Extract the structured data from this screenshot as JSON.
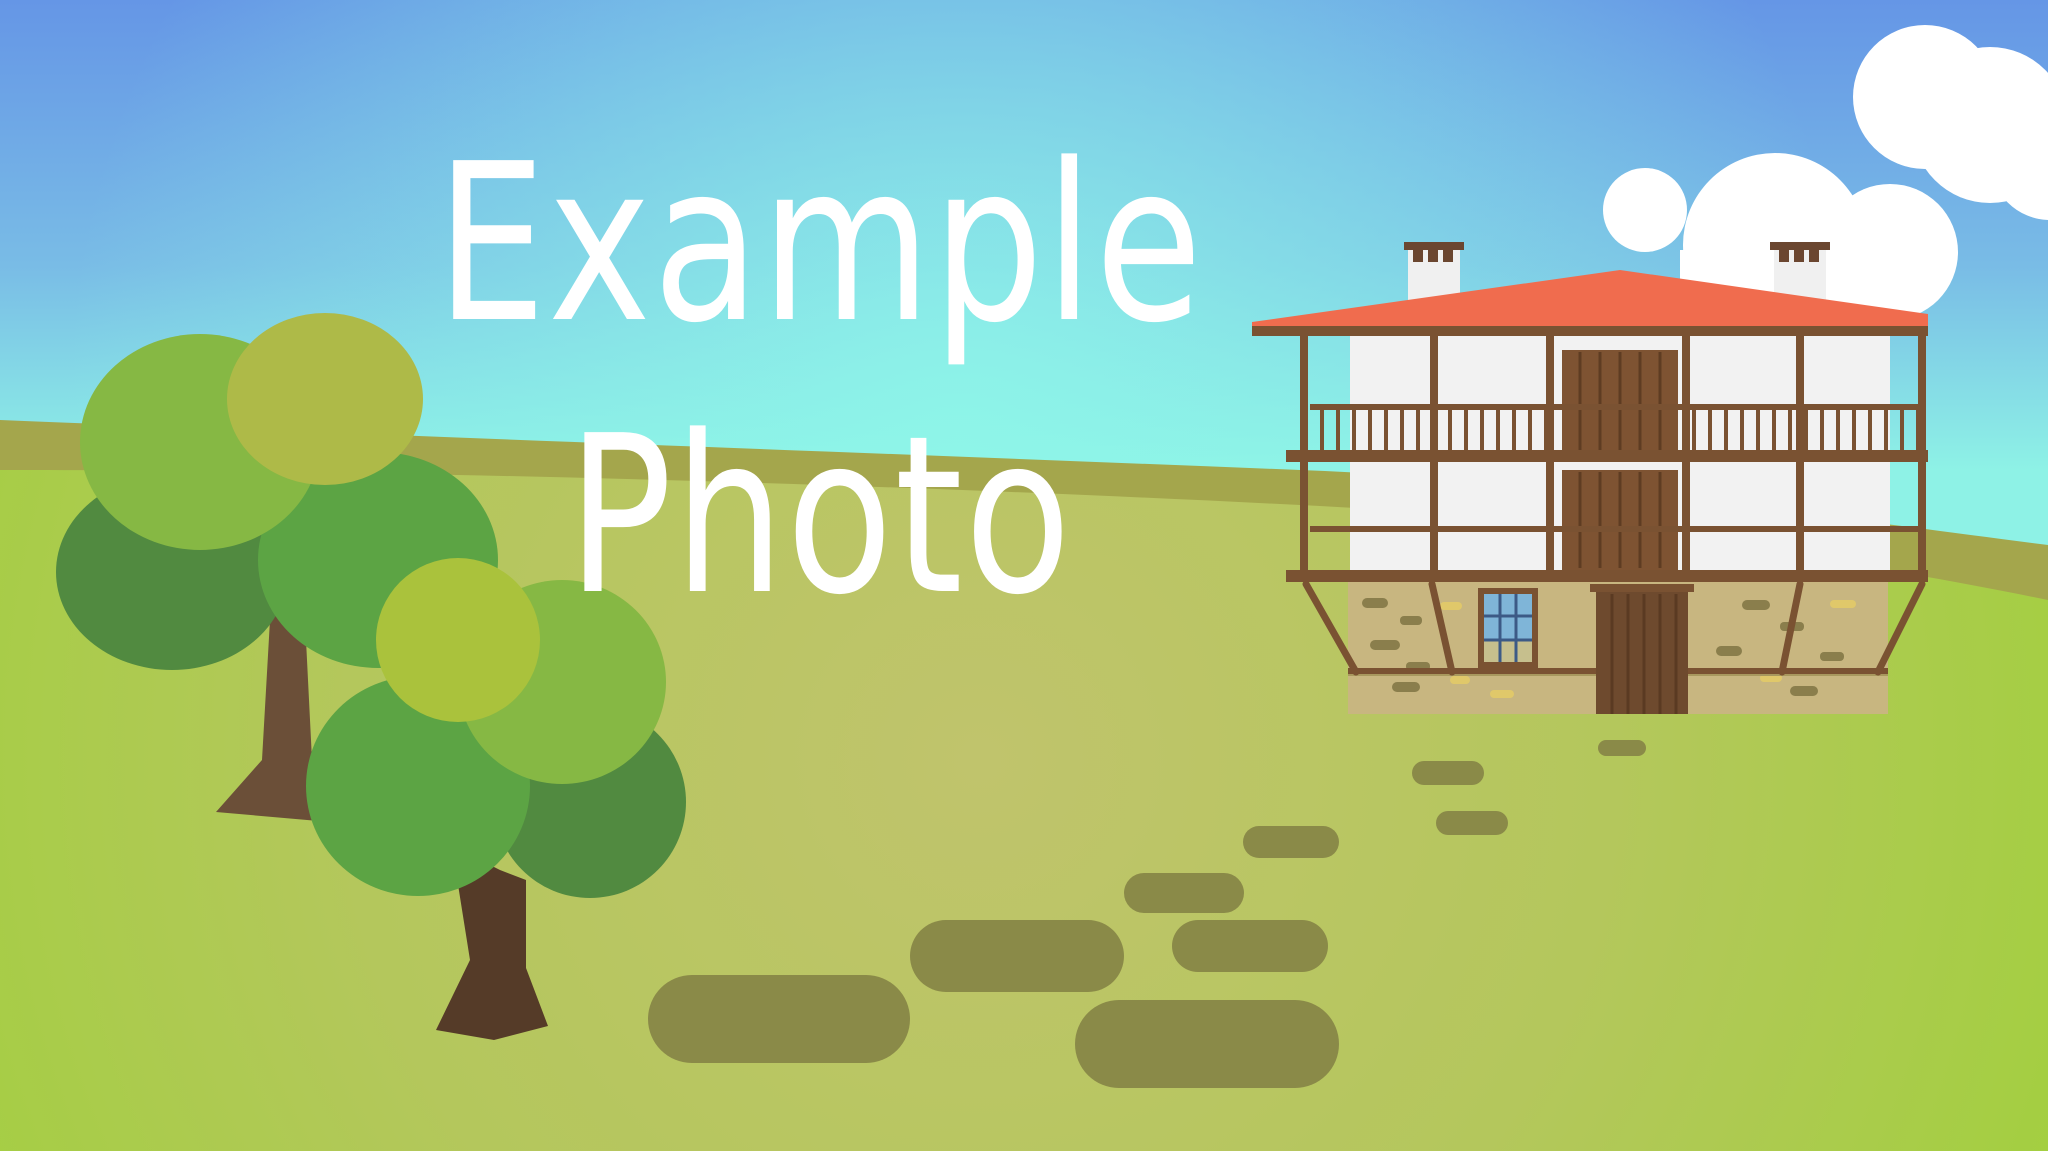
{
  "caption": {
    "line1": "Example",
    "line2": "Photo"
  },
  "colors": {
    "sky_top": "#6596e6",
    "sky_horizon": "#8ef2e6",
    "far_hill": "#a4a64c",
    "meadow": "#a9cf42",
    "meadow_glow": "#bcc668",
    "path_stone": "#8a8a48",
    "roof": "#f06c4e",
    "timber": "#7a5232",
    "wall": "#f2f2f2",
    "stone_base": "#c8b680",
    "trunk": "#6b4f38",
    "leaf_dark": "#518a40",
    "leaf_mid": "#5ca444",
    "leaf_light": "#86b844",
    "leaf_lime": "#aeba48",
    "cloud": "#ffffff"
  }
}
